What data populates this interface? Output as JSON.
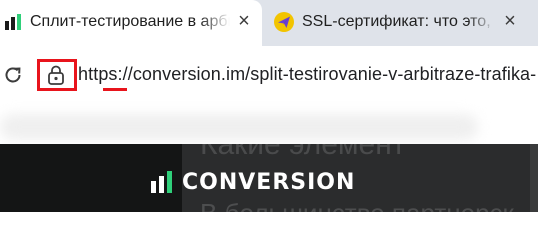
{
  "tabs": [
    {
      "title": "Сплит-тестирование в арбит",
      "icon": "conversion-favicon",
      "active": true
    },
    {
      "title": "SSL-сертификат: что это, зач",
      "icon": "paper-plane-favicon",
      "active": false
    }
  ],
  "close_glyph": "×",
  "toolbar": {
    "reload_icon": "reload-icon",
    "site_info_icon": "lock-icon",
    "url": "https://conversion.im/split-testirovanie-v-arbitraze-trafika-"
  },
  "page": {
    "heading_fragment": "Какие элемент",
    "logo_text": "CONVERSION",
    "body_fragment": "В большинстве партнерск"
  },
  "colors": {
    "highlight": "#e8141c",
    "page_bg": "#1e1f1f",
    "logo_green": "#2fd07a"
  }
}
